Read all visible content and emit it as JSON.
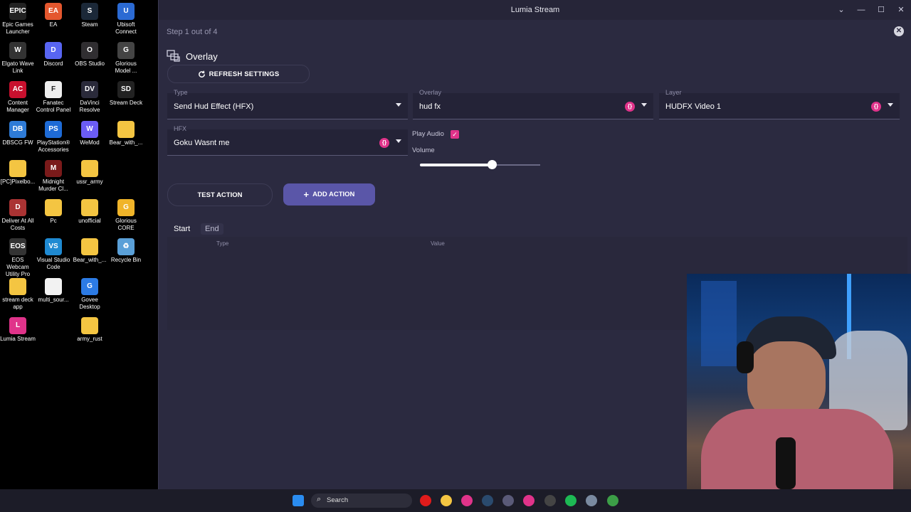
{
  "desktop": {
    "icons": [
      {
        "label": "Epic Games Launcher",
        "glyph": "EPIC",
        "color": "#222"
      },
      {
        "label": "EA",
        "glyph": "EA",
        "color": "#e4572e"
      },
      {
        "label": "Steam",
        "glyph": "S",
        "color": "#1b2838"
      },
      {
        "label": "Ubisoft Connect",
        "glyph": "U",
        "color": "#2b6ad3"
      },
      {
        "label": "Elgato Wave Link",
        "glyph": "W",
        "color": "#333"
      },
      {
        "label": "Discord",
        "glyph": "D",
        "color": "#5865f2"
      },
      {
        "label": "OBS Studio",
        "glyph": "O",
        "color": "#302e31"
      },
      {
        "label": "Glorious Model ...",
        "glyph": "G",
        "color": "#444"
      },
      {
        "label": "Content Manager",
        "glyph": "AC",
        "color": "#c8102e"
      },
      {
        "label": "Fanatec Control Panel",
        "glyph": "F",
        "color": "#eee"
      },
      {
        "label": "DaVinci Resolve",
        "glyph": "DV",
        "color": "#2a2a3a"
      },
      {
        "label": "Stream Deck",
        "glyph": "SD",
        "color": "#222"
      },
      {
        "label": "DBSCG FW",
        "glyph": "DB",
        "color": "#2e7bd6"
      },
      {
        "label": "PlayStation® Accessories",
        "glyph": "PS",
        "color": "#1e6bd6"
      },
      {
        "label": "WeMod",
        "glyph": "W",
        "color": "#6b5cf5"
      },
      {
        "label": "Bear_with_...",
        "glyph": "",
        "color": "#f4c542"
      },
      {
        "label": "[PC]Pixelbo...",
        "glyph": "",
        "color": "#f4c542"
      },
      {
        "label": "Midnight Murder Cl...",
        "glyph": "M",
        "color": "#7a1a1a"
      },
      {
        "label": "ussr_army",
        "glyph": "",
        "color": "#f4c542"
      },
      {
        "label": "Deliver At All Costs",
        "glyph": "D",
        "color": "#a33"
      },
      {
        "label": "Pc",
        "glyph": "",
        "color": "#f4c542"
      },
      {
        "label": "unofficial",
        "glyph": "",
        "color": "#f4c542"
      },
      {
        "label": "Glorious CORE",
        "glyph": "G",
        "color": "#f0b429"
      },
      {
        "label": "EOS Webcam Utility Pro",
        "glyph": "EOS",
        "color": "#333"
      },
      {
        "label": "Visual Studio Code",
        "glyph": "VS",
        "color": "#1f8ad2"
      },
      {
        "label": "Bear_with_...",
        "glyph": "",
        "color": "#f4c542"
      },
      {
        "label": "Recycle Bin",
        "glyph": "♻",
        "color": "#5aa0d8"
      },
      {
        "label": "stream deck app",
        "glyph": "",
        "color": "#f4c542"
      },
      {
        "label": "multi_sour...",
        "glyph": "",
        "color": "#f2f2f2"
      },
      {
        "label": "Govee Desktop",
        "glyph": "G",
        "color": "#2c7be5"
      },
      {
        "label": "Lumia Stream",
        "glyph": "L",
        "color": "#e0338a"
      },
      {
        "label": "army_rust",
        "glyph": "",
        "color": "#f4c542"
      }
    ]
  },
  "window": {
    "title": "Lumia Stream",
    "minimize": "—",
    "maximize": "☐",
    "close": "✕",
    "chevron": "⌄"
  },
  "wizard": {
    "step": "Step 1 out of 4",
    "close": "✕"
  },
  "section": {
    "title": "Overlay",
    "refresh_label": "REFRESH SETTINGS"
  },
  "fields": {
    "type": {
      "label": "Type",
      "value": "Send Hud Effect (HFX)"
    },
    "overlay": {
      "label": "Overlay",
      "value": "hud fx"
    },
    "layer": {
      "label": "Layer",
      "value": "HUDFX Video 1"
    },
    "hfx": {
      "label": "HFX",
      "value": "Goku Wasnt me"
    },
    "info_glyph": "{}"
  },
  "audio": {
    "play_audio_label": "Play Audio",
    "play_audio_checked": true,
    "check_glyph": "✓",
    "volume_label": "Volume",
    "volume": 0.6
  },
  "actions": {
    "test_label": "TEST ACTION",
    "add_label": "ADD ACTION",
    "add_glyph": "+"
  },
  "tabs": {
    "start": "Start",
    "end": "End"
  },
  "table": {
    "columns": [
      "Type",
      "Value"
    ]
  },
  "taskbar": {
    "search_placeholder": "Search",
    "search_glyph": "⌕",
    "icons": [
      {
        "name": "start-icon",
        "color": "#2a8cf0"
      },
      {
        "name": "opera-icon",
        "color": "#e01b1b"
      },
      {
        "name": "file-explorer-icon",
        "color": "#f4c542"
      },
      {
        "name": "opera-gx-icon",
        "color": "#e0338a"
      },
      {
        "name": "steam-icon",
        "color": "#2a4a6e"
      },
      {
        "name": "app-icon",
        "color": "#5a5a78"
      },
      {
        "name": "lumia-icon",
        "color": "#e0338a"
      },
      {
        "name": "obs-icon",
        "color": "#444"
      },
      {
        "name": "spotify-icon",
        "color": "#1db954"
      },
      {
        "name": "settings-icon",
        "color": "#7a8aa0"
      },
      {
        "name": "chrome-icon",
        "color": "#3c9e47"
      }
    ]
  }
}
